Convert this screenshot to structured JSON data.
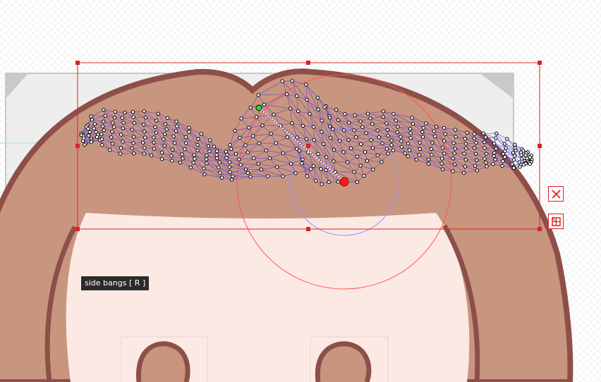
{
  "tooltip": {
    "text": "side bangs [ R ]"
  },
  "controls": {
    "delete_icon": "close-x-icon",
    "mesh_icon": "mesh-grid-icon"
  },
  "colors": {
    "hair_fill": "#c8957f",
    "hair_outline": "#8e4f49",
    "skin": "#fce9e4",
    "mesh_line": "#5b3fd9",
    "selection": "#e02020",
    "pivot": "#ff1a1a",
    "handle": "#22dd22",
    "tooltip_bg": "#2b2b2b"
  }
}
